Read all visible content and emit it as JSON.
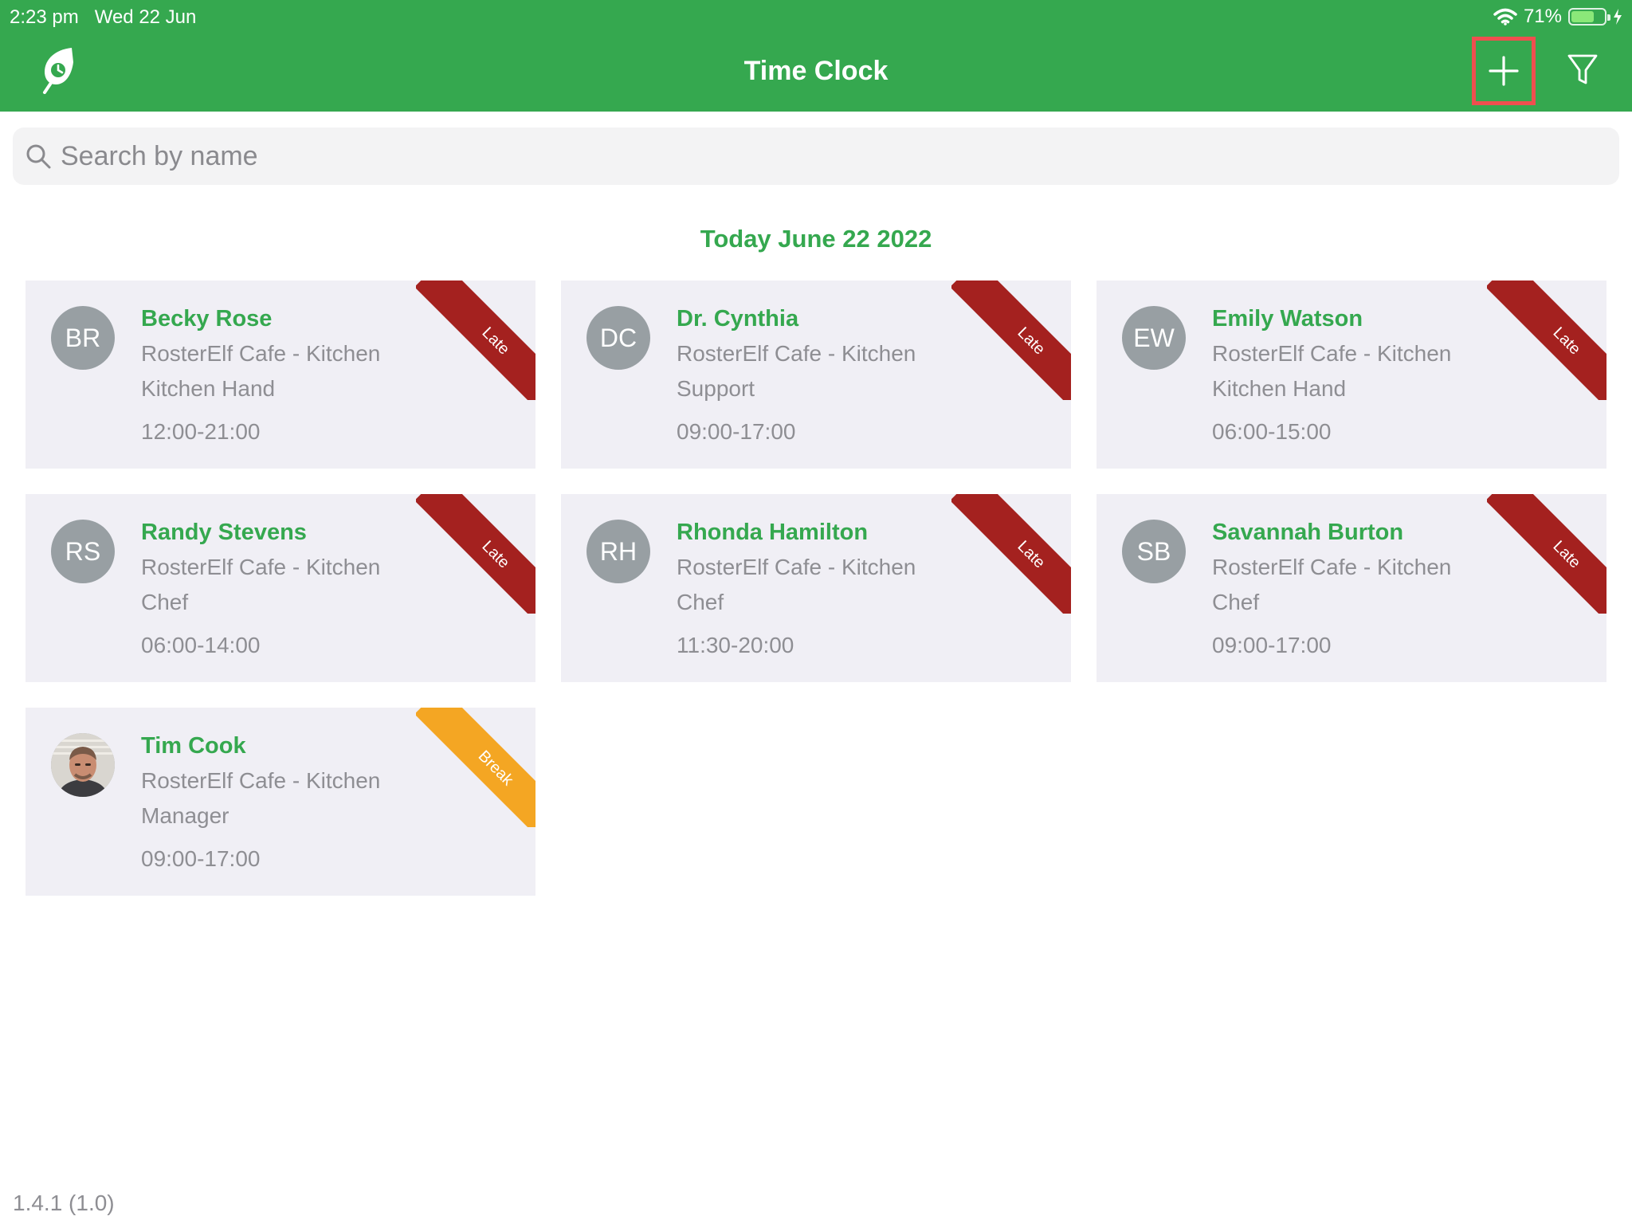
{
  "status_bar": {
    "time": "2:23 pm",
    "date": "Wed 22 Jun",
    "battery_percent": 71,
    "battery_text": "71%",
    "icons": [
      "wifi-icon",
      "battery-icon",
      "charging-bolt-icon"
    ]
  },
  "header": {
    "title": "Time Clock",
    "logo_icon": "leaf-clock-logo-icon",
    "add_icon": "plus-icon",
    "filter_icon": "filter-funnel-icon"
  },
  "search": {
    "placeholder": "Search by name",
    "value": ""
  },
  "date_heading": "Today June 22 2022",
  "shifts": [
    {
      "initials": "BR",
      "name": "Becky Rose",
      "location": "RosterElf Cafe - Kitchen",
      "role": "Kitchen Hand",
      "time": "12:00-21:00",
      "status": "Late",
      "status_type": "late"
    },
    {
      "initials": "DC",
      "name": "Dr. Cynthia",
      "location": "RosterElf Cafe - Kitchen",
      "role": "Support",
      "time": "09:00-17:00",
      "status": "Late",
      "status_type": "late"
    },
    {
      "initials": "EW",
      "name": "Emily Watson",
      "location": "RosterElf Cafe - Kitchen",
      "role": "Kitchen Hand",
      "time": "06:00-15:00",
      "status": "Late",
      "status_type": "late"
    },
    {
      "initials": "RS",
      "name": "Randy Stevens",
      "location": "RosterElf Cafe - Kitchen",
      "role": "Chef",
      "time": "06:00-14:00",
      "status": "Late",
      "status_type": "late"
    },
    {
      "initials": "RH",
      "name": "Rhonda Hamilton",
      "location": "RosterElf Cafe - Kitchen",
      "role": "Chef",
      "time": "11:30-20:00",
      "status": "Late",
      "status_type": "late"
    },
    {
      "initials": "SB",
      "name": "Savannah Burton",
      "location": "RosterElf Cafe - Kitchen",
      "role": "Chef",
      "time": "09:00-17:00",
      "status": "Late",
      "status_type": "late"
    },
    {
      "initials": "",
      "name": "Tim Cook",
      "location": "RosterElf Cafe - Kitchen",
      "role": "Manager",
      "time": "09:00-17:00",
      "status": "Break",
      "status_type": "break",
      "photo": true
    }
  ],
  "colors": {
    "brand_green": "#35a84f",
    "late_red": "#a4211f",
    "break_orange": "#f4a623",
    "highlight_red": "#ef4f4f",
    "card_bg": "#f0eff5",
    "avatar_gray": "#989fa3"
  },
  "version": "1.4.1 (1.0)"
}
